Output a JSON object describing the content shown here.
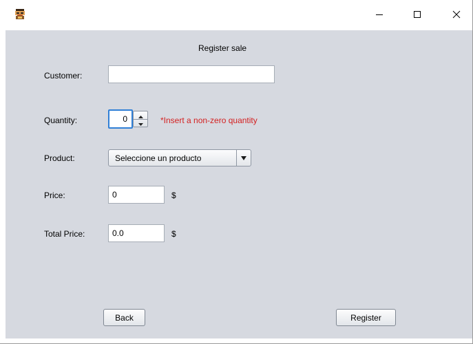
{
  "window": {
    "icon": "app-character-icon",
    "controls": {
      "minimize": "minimize-icon",
      "maximize": "maximize-icon",
      "close": "close-icon"
    }
  },
  "form": {
    "title": "Register sale",
    "customer": {
      "label": "Customer:",
      "value": ""
    },
    "quantity": {
      "label": "Quantity:",
      "value": "0",
      "error": "*Insert a non-zero quantity"
    },
    "product": {
      "label": "Product:",
      "selected": "Seleccione un producto"
    },
    "price": {
      "label": "Price:",
      "value": "0",
      "unit": "$"
    },
    "total_price": {
      "label": "Total Price:",
      "value": "0.0",
      "unit": "$"
    },
    "buttons": {
      "back": "Back",
      "register": "Register"
    }
  },
  "colors": {
    "panel_bg": "#d6d9e0",
    "error": "#d42020",
    "focus_border": "#2f7fd6"
  }
}
